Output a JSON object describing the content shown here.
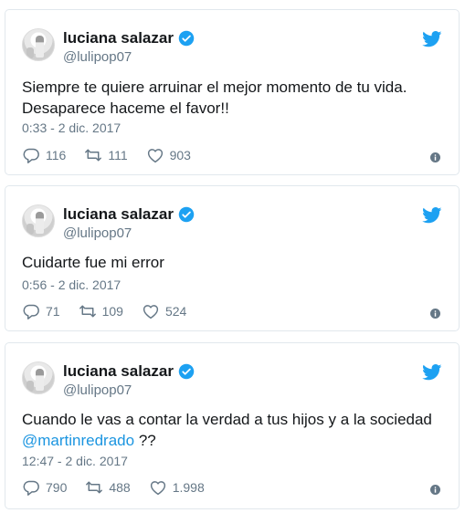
{
  "tweets": [
    {
      "name": "luciana salazar",
      "handle": "@lulipop07",
      "text": "Siempre te quiere arruinar el mejor momento de tu vida. Desaparece haceme el favor!!",
      "text_line1": "Siempre te quiere arruinar el mejor momento de tu vida.",
      "text_line2": "Desaparece haceme el favor!!",
      "timestamp": "0:33 - 2 dic. 2017",
      "replies": "116",
      "retweets": "111",
      "likes": "903"
    },
    {
      "name": "luciana salazar",
      "handle": "@lulipop07",
      "text": "Cuidarte fue mi error",
      "timestamp": "0:56 - 2 dic. 2017",
      "replies": "71",
      "retweets": "109",
      "likes": "524"
    },
    {
      "name": "luciana salazar",
      "handle": "@lulipop07",
      "text_line1": "Cuando le vas a contar la verdad a tus hijos y a la sociedad",
      "mention": "@martinredrado",
      "text_suffix": " ??",
      "timestamp": "12:47 - 2 dic. 2017",
      "replies": "790",
      "retweets": "488",
      "likes": "1.998"
    }
  ],
  "icons": {
    "verified": "verified-badge-icon",
    "brand": "twitter-bird-icon",
    "reply": "reply-icon",
    "retweet": "retweet-icon",
    "like": "heart-icon",
    "info": "info-icon"
  },
  "colors": {
    "brand_blue": "#1da1f2",
    "mention_blue": "#1b95e0",
    "muted": "#657786",
    "border": "#e1e8ed"
  }
}
